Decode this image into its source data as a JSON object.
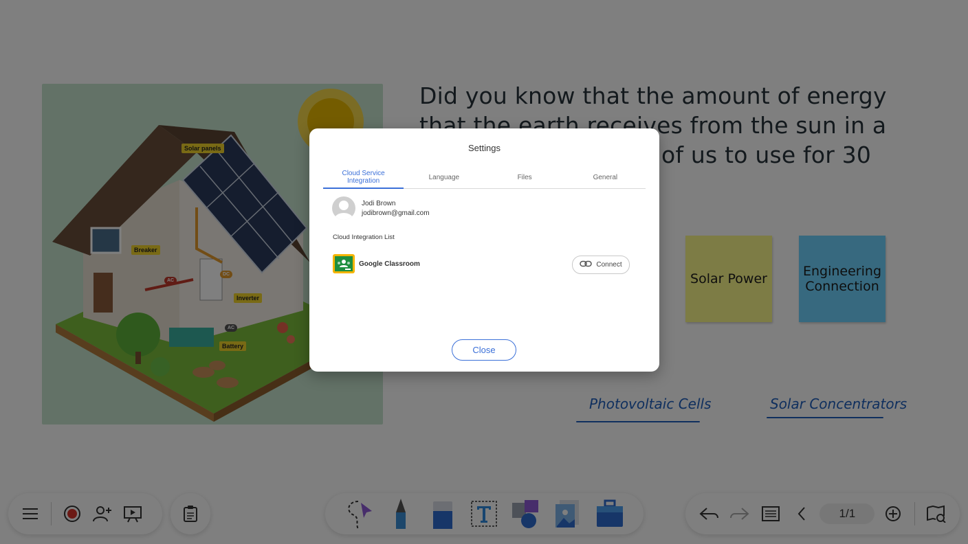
{
  "board": {
    "question": "Did you know that the amount of energy that the earth receives from the sun in a day is enough for all of us to use for 30 years?",
    "illustration_tags": {
      "solar_panels": "Solar panels",
      "breaker": "Breaker",
      "inverter": "Inverter",
      "battery": "Battery",
      "ac1": "AC",
      "dc": "DC",
      "ac2": "AC"
    },
    "sticky_notes": [
      {
        "text": "Solar Power",
        "color": "#fbf88a"
      },
      {
        "text": "Engineering Connection",
        "color": "#6fd3ff"
      }
    ],
    "handwritten": [
      {
        "text": "Photovoltaic Cells"
      },
      {
        "text": "Solar Concentrators"
      }
    ]
  },
  "toolbar": {
    "left": [
      "menu-icon",
      "record-icon",
      "add-user-icon",
      "present-icon"
    ],
    "clipboard": "clipboard-icon",
    "tools": [
      "lasso-select-icon",
      "pen-icon",
      "eraser-icon",
      "text-icon",
      "shapes-icon",
      "image-icon",
      "toolbox-icon"
    ],
    "right": [
      "undo-icon",
      "redo-icon",
      "page-settings-icon",
      "prev-page-icon",
      "add-page-icon",
      "page-overview-icon"
    ],
    "page_indicator": "1/1"
  },
  "dialog": {
    "title": "Settings",
    "tabs": [
      {
        "label": "Cloud Service Integration",
        "active": true
      },
      {
        "label": "Language",
        "active": false
      },
      {
        "label": "Files",
        "active": false
      },
      {
        "label": "General",
        "active": false
      }
    ],
    "user": {
      "name": "Jodi Brown",
      "email": "jodibrown@gmail.com"
    },
    "list_label": "Cloud Integration List",
    "integrations": [
      {
        "name": "Google Classroom",
        "action": "Connect"
      }
    ],
    "close_label": "Close",
    "accent": "#3a6fd8"
  }
}
